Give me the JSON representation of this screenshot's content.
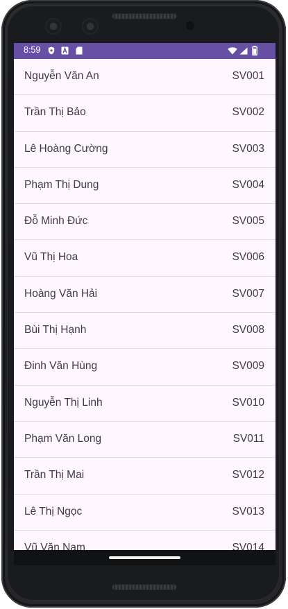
{
  "status_bar": {
    "time": "8:59",
    "background": "#6750a4",
    "icons_left": [
      "shield-icon",
      "text-a-icon",
      "sd-card-icon"
    ],
    "icons_right": [
      "wifi-icon",
      "cell-signal-icon",
      "battery-icon"
    ]
  },
  "students": [
    {
      "name": "Nguyễn Văn An",
      "id": "SV001"
    },
    {
      "name": "Trần Thị Bảo",
      "id": "SV002"
    },
    {
      "name": "Lê Hoàng Cường",
      "id": "SV003"
    },
    {
      "name": "Phạm Thị Dung",
      "id": "SV004"
    },
    {
      "name": "Đỗ Minh Đức",
      "id": "SV005"
    },
    {
      "name": "Vũ Thị Hoa",
      "id": "SV006"
    },
    {
      "name": "Hoàng Văn Hải",
      "id": "SV007"
    },
    {
      "name": "Bùi Thị Hạnh",
      "id": "SV008"
    },
    {
      "name": "Đinh Văn Hùng",
      "id": "SV009"
    },
    {
      "name": "Nguyễn Thị Linh",
      "id": "SV010"
    },
    {
      "name": "Phạm Văn Long",
      "id": "SV011"
    },
    {
      "name": "Trần Thị Mai",
      "id": "SV012"
    },
    {
      "name": "Lê Thị Ngọc",
      "id": "SV013"
    },
    {
      "name": "Vũ Văn Nam",
      "id": "SV014"
    }
  ],
  "theme": {
    "screen_background": "#fef7ff",
    "divider": "#dedbe2",
    "text": "#3d3b40"
  }
}
